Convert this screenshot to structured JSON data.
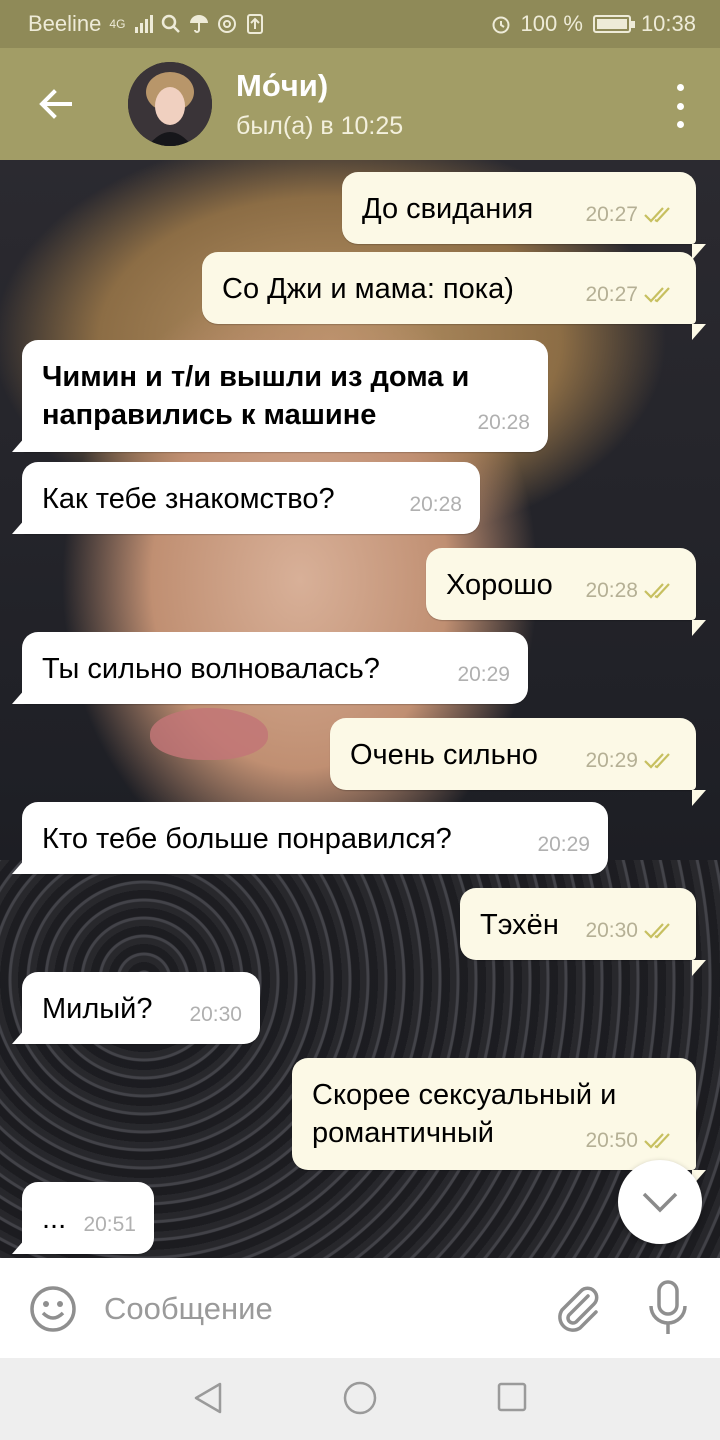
{
  "status_bar": {
    "carrier": "Beeline",
    "network": "4G",
    "battery": "100 %",
    "battery_level": 1.0,
    "time": "10:38"
  },
  "header": {
    "title": "Мо́чи)",
    "subtitle": "был(а) в 10:25"
  },
  "messages": [
    {
      "text": "До свидания",
      "time": "20:27",
      "direction": "out"
    },
    {
      "text": "Со Джи и мама: пока)",
      "time": "20:27",
      "direction": "out"
    },
    {
      "text": "Чимин и т/и вышли из дома и направились к машине",
      "time": "20:28",
      "direction": "in"
    },
    {
      "text": "Как тебе знакомство?",
      "time": "20:28",
      "direction": "in"
    },
    {
      "text": "Хорошо",
      "time": "20:28",
      "direction": "out"
    },
    {
      "text": "Ты сильно волновалась?",
      "time": "20:29",
      "direction": "in"
    },
    {
      "text": "Очень сильно",
      "time": "20:29",
      "direction": "out"
    },
    {
      "text": "Кто тебе больше понравился?",
      "time": "20:29",
      "direction": "in"
    },
    {
      "text": "Тэхён",
      "time": "20:30",
      "direction": "out"
    },
    {
      "text": "Милый?",
      "time": "20:30",
      "direction": "in"
    },
    {
      "text": "Скорее сексуальный и романтичный",
      "time": "20:50",
      "direction": "out"
    },
    {
      "text": "...",
      "time": "20:51",
      "direction": "in"
    }
  ],
  "input": {
    "placeholder": "Сообщение"
  },
  "colors": {
    "header": "#a29d66",
    "status_bar": "#8f8a58",
    "outgoing_bubble": "#fcf9e6",
    "incoming_bubble": "#ffffff",
    "read_check": "#c7c060"
  },
  "icons": [
    "back-arrow-icon",
    "more-vert-icon",
    "double-check-icon",
    "chevron-down-icon",
    "emoji-icon",
    "paperclip-icon",
    "microphone-icon",
    "nav-back-icon",
    "nav-home-icon",
    "nav-recent-icon"
  ]
}
